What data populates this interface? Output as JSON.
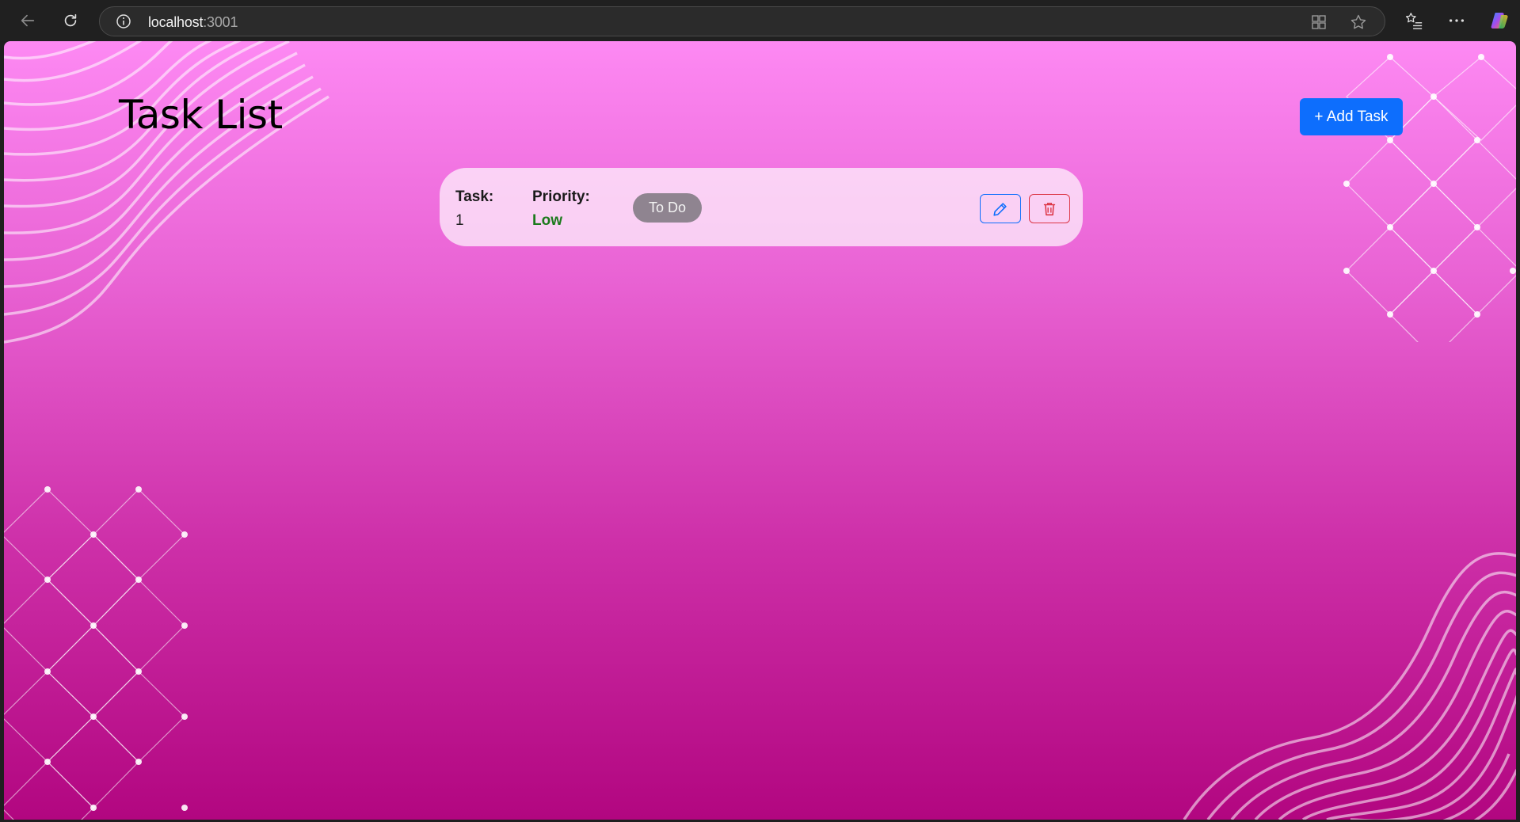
{
  "browser": {
    "url_host": "localhost",
    "url_port": ":3001"
  },
  "page": {
    "title": "Task List",
    "add_button_label": "+ Add Task"
  },
  "tasks": [
    {
      "task_label": "Task:",
      "task_value": "1",
      "priority_label": "Priority:",
      "priority_value": "Low",
      "status": "To Do"
    }
  ],
  "colors": {
    "primary": "#0d6efd",
    "danger": "#dc3545",
    "priority_low": "#1c7a1c",
    "gradient_top": "#fd89f3",
    "gradient_bottom": "#b20680"
  }
}
